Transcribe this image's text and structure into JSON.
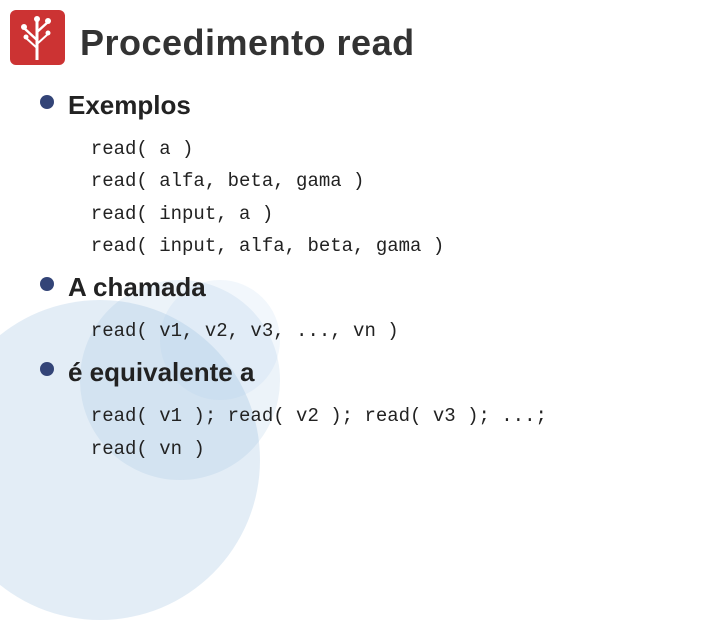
{
  "title": "Procedimento read",
  "logo": {
    "alt": "logo"
  },
  "sections": [
    {
      "id": "exemplos",
      "label": "Exemplos",
      "code": [
        "read( a )",
        "read( alfa, beta, gama )",
        "read( input, a )",
        "read( input, alfa, beta, gama )"
      ]
    },
    {
      "id": "chamada",
      "label": "A chamada",
      "code": [
        "read( v1, v2, v3, ..., vn )"
      ]
    },
    {
      "id": "equivalente",
      "label": "é equivalente a",
      "code": [
        "read( v1 ); read( v2 ); read( v3 ); ...;",
        "read( vn )"
      ]
    }
  ]
}
